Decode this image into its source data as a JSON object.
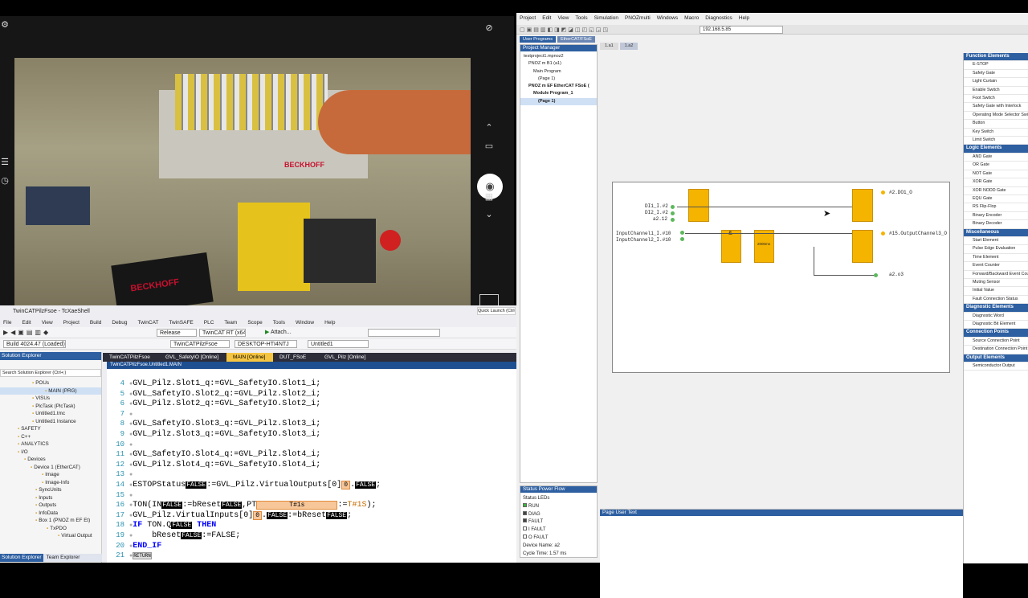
{
  "camera": {
    "photo_brand_1": "BECKHOFF",
    "photo_brand_2": "BECKHOFF",
    "icons": [
      "gear-icon",
      "camera-off-icon",
      "chevron-up-icon",
      "video-icon",
      "camera-icon",
      "grid-icon",
      "chevron-down-icon",
      "sliders-icon",
      "timer-off-icon"
    ]
  },
  "vs": {
    "title": "TwinCATPilzFsoe - TcXaeShell",
    "quick_launch": "Quick Launch (Ctrl+Q)",
    "menu": [
      "File",
      "Edit",
      "View",
      "Project",
      "Build",
      "Debug",
      "TwinCAT",
      "TwinSAFE",
      "PLC",
      "Team",
      "Scope",
      "Tools",
      "Window",
      "Help"
    ],
    "toolbar": {
      "release": "Release",
      "target": "TwinCAT RT (x64)",
      "attach": "Attach...",
      "build": "Build 4024.47 (Loaded)",
      "project": "TwinCATPilzFsoe",
      "device": "DESKTOP-HTI4NTJ",
      "untitled": "Untitled1"
    },
    "solution_explorer": {
      "title": "Solution Explorer",
      "search": "Search Solution Explorer (Ctrl+;)",
      "items": [
        "POUs",
        "MAIN (PRG)",
        "VISUs",
        "PlcTask (PlcTask)",
        "Untitled1.tmc",
        "Untitled1 Instance",
        "SAFETY",
        "C++",
        "ANALYTICS",
        "I/O",
        "Devices",
        "Device 1 (EtherCAT)",
        "Image",
        "Image-Info",
        "SyncUnits",
        "Inputs",
        "Outputs",
        "InfoData",
        "Box 1 (PNOZ m EF Et)",
        "TxPDO",
        "Virtual Output"
      ],
      "bottom_tabs": [
        "Solution Explorer",
        "Team Explorer"
      ]
    },
    "doc_tabs": [
      "TwinCATPilzFsoe",
      "GVL_SafetyIO [Online]",
      "MAIN [Online]",
      "DUT_FSoE",
      "GVL_Pilz [Online]"
    ],
    "active_doc": "TwinCATPilzFsoe.Untitled1.MAIN",
    "code": {
      "l4": "GVL_Pilz.Slot1_q:=GVL_SafetyIO.Slot1_i;",
      "l5": "GVL_SafetyIO.Slot2_q:=GVL_Pilz.Slot2_i;",
      "l6": "GVL_Pilz.Slot2_q:=GVL_SafetyIO.Slot2_i;",
      "l8": "GVL_SafetyIO.Slot3_q:=GVL_Pilz.Slot3_i;",
      "l9": "GVL_Pilz.Slot3_q:=GVL_SafetyIO.Slot3_i;",
      "l11": "GVL_SafetyIO.Slot4_q:=GVL_Pilz.Slot4_i;",
      "l12": "GVL_Pilz.Slot4_q:=GVL_SafetyIO.Slot4_i;",
      "false": "FALSE",
      "zero": "0",
      "t1s": "T#1s",
      "t1s_upper": "T#1S",
      "return": "RETURN"
    }
  },
  "pnoz": {
    "menu": [
      "Project",
      "Edit",
      "View",
      "Tools",
      "Simulation",
      "PNOZmulti",
      "Windows",
      "Macro",
      "Diagnostics",
      "Help"
    ],
    "ip": "192.168.5.85",
    "tabs": [
      "User Programs",
      "EtherCAT/FSoE"
    ],
    "project_manager": {
      "title": "Project Manager",
      "items": [
        "testproject1.mpnoz2",
        "PNOZ m B1 (a1)",
        "Main Program",
        "(Page 1)",
        "PNOZ m EF EtherCAT FSoE (",
        "Module Program_1",
        "(Page 1)"
      ]
    },
    "page_tabs": [
      "1.a1",
      "1.a2"
    ],
    "diagram": {
      "inputs_left": [
        "DI1_I.#2",
        "DI2_I.#2",
        "a2.12"
      ],
      "inputs_channels": [
        "InputChannel1_I.#10",
        "InputChannel2_I.#10"
      ],
      "outputs": [
        "#2.DO1_O",
        "#15.OutputChannel3_O",
        "a2.o3"
      ],
      "timer_label": "2000ms"
    },
    "right_panel": {
      "function_elements": {
        "title": "Function Elements",
        "items": [
          "E-STOP",
          "Safety Gate",
          "Light Curtain",
          "Enable Switch",
          "Foot Switch",
          "Safety Gate with Interlock",
          "Operating Mode Selector Switch",
          "Button",
          "Key Switch",
          "Limit Switch"
        ]
      },
      "logic_elements": {
        "title": "Logic Elements",
        "items": [
          "AND Gate",
          "OR Gate",
          "NOT Gate",
          "XOR Gate",
          "XOR NODD Gate",
          "EQU Gate",
          "RS Flip-Flop",
          "Binary Encoder",
          "Binary Decoder"
        ]
      },
      "misc": {
        "title": "Miscellaneous",
        "items": [
          "Start Element",
          "Pulse Edge Evaluation",
          "Time Element",
          "Event Counter",
          "Forward/Backward Event Counter",
          "Muting Sensor",
          "Initial Value",
          "Fault Connection Status"
        ]
      },
      "diagnostic": {
        "title": "Diagnostic Elements",
        "items": [
          "Diagnostic Word",
          "Diagnostic Bit Element"
        ]
      },
      "connection": {
        "title": "Connection Points",
        "items": [
          "Source Connection Point",
          "Destination Connection Point"
        ]
      },
      "output_elements": {
        "title": "Output Elements",
        "items": [
          "Semiconductor Output"
        ]
      }
    },
    "status": {
      "title": "Status Power Flow",
      "leds_label": "Status LEDs",
      "leds": [
        {
          "name": "RUN",
          "color": "#3cb43c"
        },
        {
          "name": "DIAG",
          "color": "#444444"
        },
        {
          "name": "FAULT",
          "color": "#444444"
        },
        {
          "name": "I FAULT",
          "color": "#ffffff"
        },
        {
          "name": "O FAULT",
          "color": "#ffffff"
        }
      ],
      "device_name": "Device Name: a2",
      "cycle_time": "Cycle Time: 1.57 ms"
    },
    "page_user_text": "Page User Text"
  }
}
